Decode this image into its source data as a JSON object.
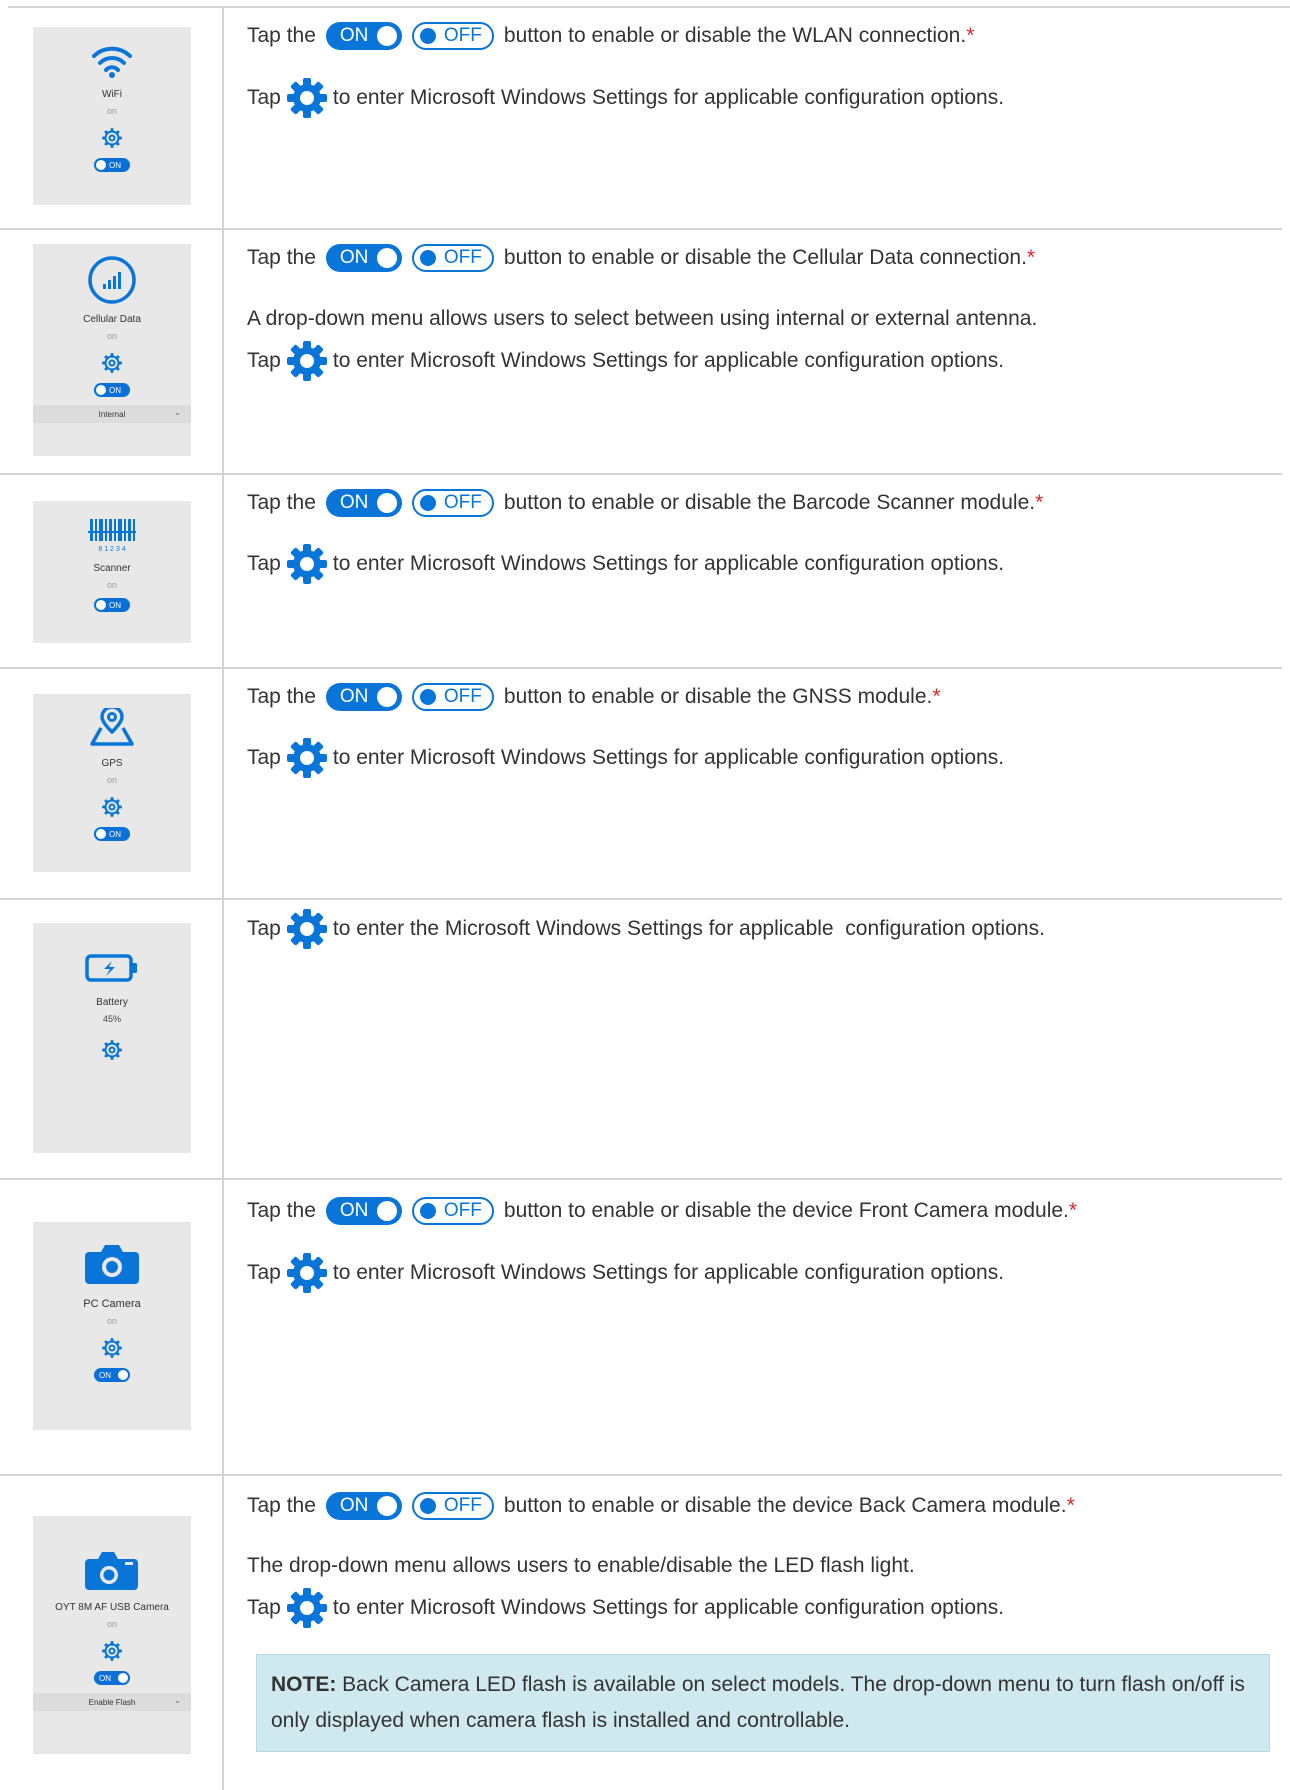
{
  "toggle": {
    "on_label": "ON",
    "off_label": "OFF"
  },
  "rows": [
    {
      "tile": {
        "name": "WiFi",
        "state": "on",
        "toggle": "ON"
      },
      "line1_pre": "Tap the",
      "line1_post": "button to enable or disable the WLAN connection.",
      "line2_pre": "Tap",
      "line2_post": "to enter Microsoft Windows Settings for applicable configuration options."
    },
    {
      "tile": {
        "name": "Cellular Data",
        "state": "on",
        "toggle": "ON",
        "dropdown": "Internal"
      },
      "line1_pre": "Tap the",
      "line1_post": "button to enable or disable the Cellular Data connection.",
      "line_mid": "A drop-down menu allows users to select between using internal or external antenna.",
      "line2_pre": "Tap",
      "line2_post": "to enter Microsoft Windows Settings for applicable configuration options."
    },
    {
      "tile": {
        "name": "Scanner",
        "state": "on",
        "toggle": "ON"
      },
      "line1_pre": "Tap the",
      "line1_post": "button to enable or disable the Barcode Scanner module.",
      "line2_pre": "Tap",
      "line2_post": "to enter Microsoft Windows Settings for applicable configuration options."
    },
    {
      "tile": {
        "name": "GPS",
        "state": "on",
        "toggle": "ON"
      },
      "line1_pre": "Tap the",
      "line1_post": "button to enable or disable the GNSS module.",
      "line2_pre": "Tap",
      "line2_post": "to enter Microsoft Windows Settings for applicable configuration options."
    },
    {
      "tile": {
        "name": "Battery",
        "state": "45%"
      },
      "line2_pre": "Tap",
      "line2_post": "to enter the Microsoft Windows Settings for applicable  configuration options."
    },
    {
      "tile": {
        "name": "PC Camera",
        "state": "on",
        "toggle": "ON"
      },
      "line1_pre": "Tap the",
      "line1_post": "button to enable or disable the device Front Camera module.",
      "line2_pre": "Tap",
      "line2_post": "to enter Microsoft Windows Settings for applicable configuration options."
    },
    {
      "tile": {
        "name": "OYT 8M AF USB Camera",
        "state": "on",
        "toggle": "ON",
        "dropdown": "Enable Flash"
      },
      "line1_pre": "Tap the",
      "line1_post": "button to enable or disable the device Back Camera module.",
      "line_mid": "The drop-down menu allows users to enable/disable the LED flash light.",
      "line2_pre": "Tap",
      "line2_post": "to enter Microsoft Windows Settings for applicable configuration options."
    }
  ],
  "note": {
    "label": "NOTE:",
    "text": " Back Camera LED flash is available on select models. The drop-down menu to turn flash on/off is only displayed when camera flash is installed and controllable."
  },
  "star": "*",
  "colors": {
    "accent": "#0a75d9",
    "star": "#d9262c",
    "tile_bg": "#e8e8e8",
    "note_bg": "#cfe9ef"
  }
}
